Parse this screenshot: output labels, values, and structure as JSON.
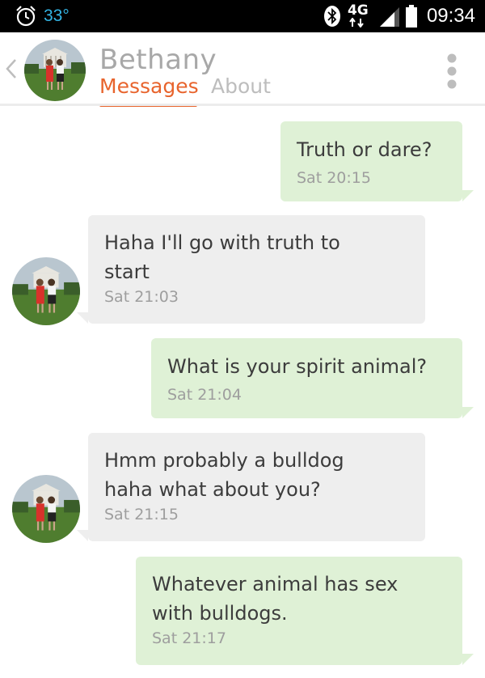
{
  "status_bar": {
    "temperature": "33°",
    "network": "4G",
    "time": "09:34"
  },
  "header": {
    "contact_name": "Bethany",
    "tabs": [
      {
        "label": "Messages",
        "active": true
      },
      {
        "label": "About",
        "active": false
      }
    ]
  },
  "messages": [
    {
      "direction": "outgoing",
      "text": "Truth or dare?",
      "time": "Sat 20:15"
    },
    {
      "direction": "incoming",
      "lines": [
        "Haha I'll go with truth to",
        "start"
      ],
      "time": "Sat 21:03"
    },
    {
      "direction": "outgoing",
      "text": "What is your spirit animal?",
      "time": "Sat 21:04"
    },
    {
      "direction": "incoming",
      "lines": [
        "Hmm probably a bulldog",
        "haha what about you?"
      ],
      "time": "Sat 21:15"
    },
    {
      "direction": "outgoing",
      "lines": [
        "Whatever animal has sex",
        "with bulldogs."
      ],
      "time": "Sat 21:17"
    }
  ],
  "colors": {
    "accent": "#e8642d",
    "outgoing_bubble": "#dff1d6",
    "incoming_bubble": "#eeeeee",
    "status_temp": "#33b5e5"
  },
  "icons": [
    "alarm-clock-icon",
    "bluetooth-icon",
    "network-4g-icon",
    "signal-icon",
    "battery-icon",
    "back-chevron-icon",
    "overflow-menu-icon"
  ]
}
